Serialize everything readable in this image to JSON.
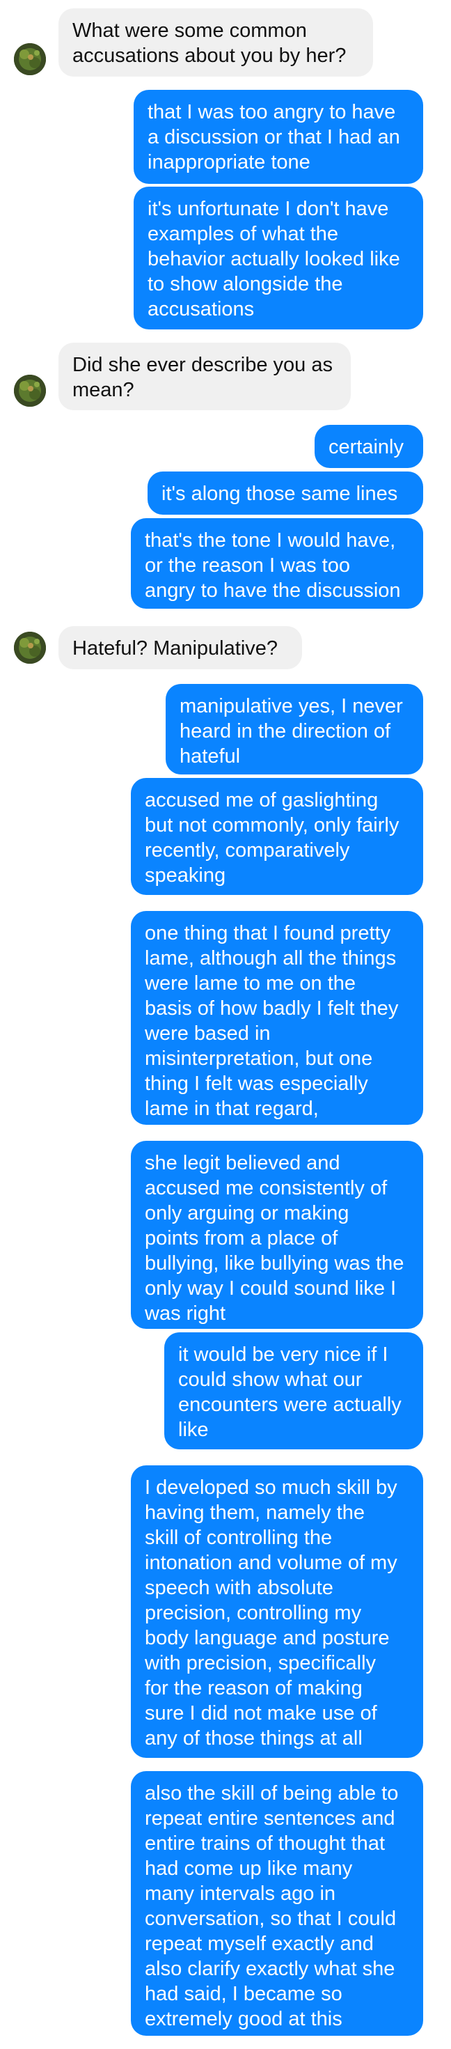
{
  "colors": {
    "incoming_bubble": "#f0f0f0",
    "incoming_text": "#111111",
    "outgoing_bubble": "#0a84ff",
    "outgoing_text": "#ffffff",
    "background": "#ffffff"
  },
  "contact": {
    "avatar_icon": "profile-photo-green-foliage"
  },
  "messages": [
    {
      "sender": "them",
      "text": "What were some common\naccusations about you by her?"
    },
    {
      "sender": "me",
      "text": "that I was too angry to have\na discussion or that I had an\ninappropriate tone"
    },
    {
      "sender": "me",
      "text": "it's unfortunate I don't have\nexamples of what the\nbehavior actually looked like\nto show alongside the\naccusations"
    },
    {
      "sender": "them",
      "text": "Did she ever describe you as\nmean?"
    },
    {
      "sender": "me",
      "text": "certainly"
    },
    {
      "sender": "me",
      "text": "it's along those same lines"
    },
    {
      "sender": "me",
      "text": "that's the tone I would have,\nor the reason I was too\nangry to have the discussion"
    },
    {
      "sender": "them",
      "text": "Hateful? Manipulative?"
    },
    {
      "sender": "me",
      "text": "manipulative yes, I never\nheard in the direction of\nhateful"
    },
    {
      "sender": "me",
      "text": "accused me of gaslighting\nbut not commonly, only fairly\nrecently, comparatively\nspeaking"
    },
    {
      "sender": "me",
      "text": "one thing that I found pretty\nlame, although all the things\nwere lame to me on the\nbasis of how badly I felt they\nwere based in\nmisinterpretation, but one\nthing I felt was especially\nlame in that regard,"
    },
    {
      "sender": "me",
      "text": "she legit believed and\naccused me consistently of\nonly arguing or making\npoints from a place of\nbullying, like bullying was the\nonly way I could sound like I\nwas right"
    },
    {
      "sender": "me",
      "text": "it would be very nice if I\ncould show what our\nencounters were actually\nlike"
    },
    {
      "sender": "me",
      "text": "I developed so much skill by\nhaving them, namely the\nskill of controlling the\nintonation and volume of my\nspeech with absolute\nprecision, controlling my\nbody language and posture\nwith precision, specifically\nfor the reason of making\nsure I did not make use of\nany of those things at all"
    },
    {
      "sender": "me",
      "text": "also the skill of being able to\nrepeat entire sentences and\nentire trains of thought that\nhad come up like many\nmany intervals ago in\nconversation, so that I could\nrepeat myself exactly and\nalso clarify exactly what she\nhad said, I became so\nextremely good at this"
    }
  ]
}
